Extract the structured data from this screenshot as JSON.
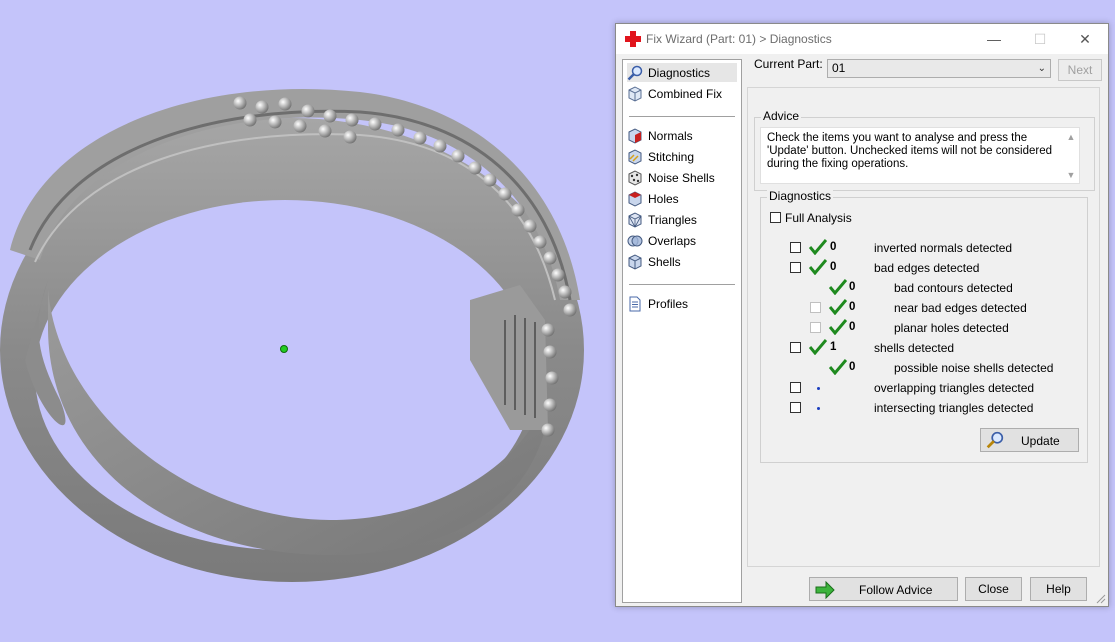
{
  "window": {
    "title": "Fix Wizard (Part: 01) > Diagnostics",
    "minimize_glyph": "—",
    "maximize_glyph": "☐",
    "close_glyph": "✕"
  },
  "nav": {
    "items": [
      {
        "label": "Diagnostics",
        "icon": "magnifier-icon"
      },
      {
        "label": "Combined Fix",
        "icon": "cube-stack-icon"
      },
      {
        "label": "Normals",
        "icon": "normals-cube-icon"
      },
      {
        "label": "Stitching",
        "icon": "stitching-cube-icon"
      },
      {
        "label": "Noise Shells",
        "icon": "noise-shells-icon"
      },
      {
        "label": "Holes",
        "icon": "holes-cube-icon"
      },
      {
        "label": "Triangles",
        "icon": "triangles-cube-icon"
      },
      {
        "label": "Overlaps",
        "icon": "overlaps-icon"
      },
      {
        "label": "Shells",
        "icon": "shells-cube-icon"
      },
      {
        "label": "Profiles",
        "icon": "document-icon"
      }
    ],
    "selected": "Diagnostics"
  },
  "current_part": {
    "label": "Current Part:",
    "value": "01",
    "next_label": "Next"
  },
  "advice": {
    "title": "Advice",
    "text_lines": [
      "Check the items you want to analyse and press the",
      "'Update' button. Unchecked items will not be considered",
      "during the fixing operations."
    ]
  },
  "diagnostics": {
    "title": "Diagnostics",
    "full_analysis_label": "Full Analysis",
    "rows": [
      {
        "count": "0",
        "text": "inverted normals detected",
        "status": "ok"
      },
      {
        "count": "0",
        "text": "bad edges detected",
        "status": "ok"
      },
      {
        "count": "0",
        "text": "bad contours detected",
        "status": "ok"
      },
      {
        "count": "0",
        "text": "near bad edges detected",
        "status": "ok"
      },
      {
        "count": "0",
        "text": "planar holes detected",
        "status": "ok"
      },
      {
        "count": "1",
        "text": "shells detected",
        "status": "ok"
      },
      {
        "count": "0",
        "text": "possible noise shells detected",
        "status": "ok"
      },
      {
        "count": "",
        "text": "overlapping triangles detected",
        "status": "pending"
      },
      {
        "count": "",
        "text": "intersecting triangles detected",
        "status": "pending"
      }
    ],
    "update_label": "Update"
  },
  "footer": {
    "follow_advice_label": "Follow Advice",
    "close_label": "Close",
    "help_label": "Help"
  },
  "colors": {
    "viewport_bg": "#c4c4fa",
    "ring": "#8e8e8e",
    "check_green": "#1f8a1f",
    "pivot_green": "#22cc22"
  }
}
